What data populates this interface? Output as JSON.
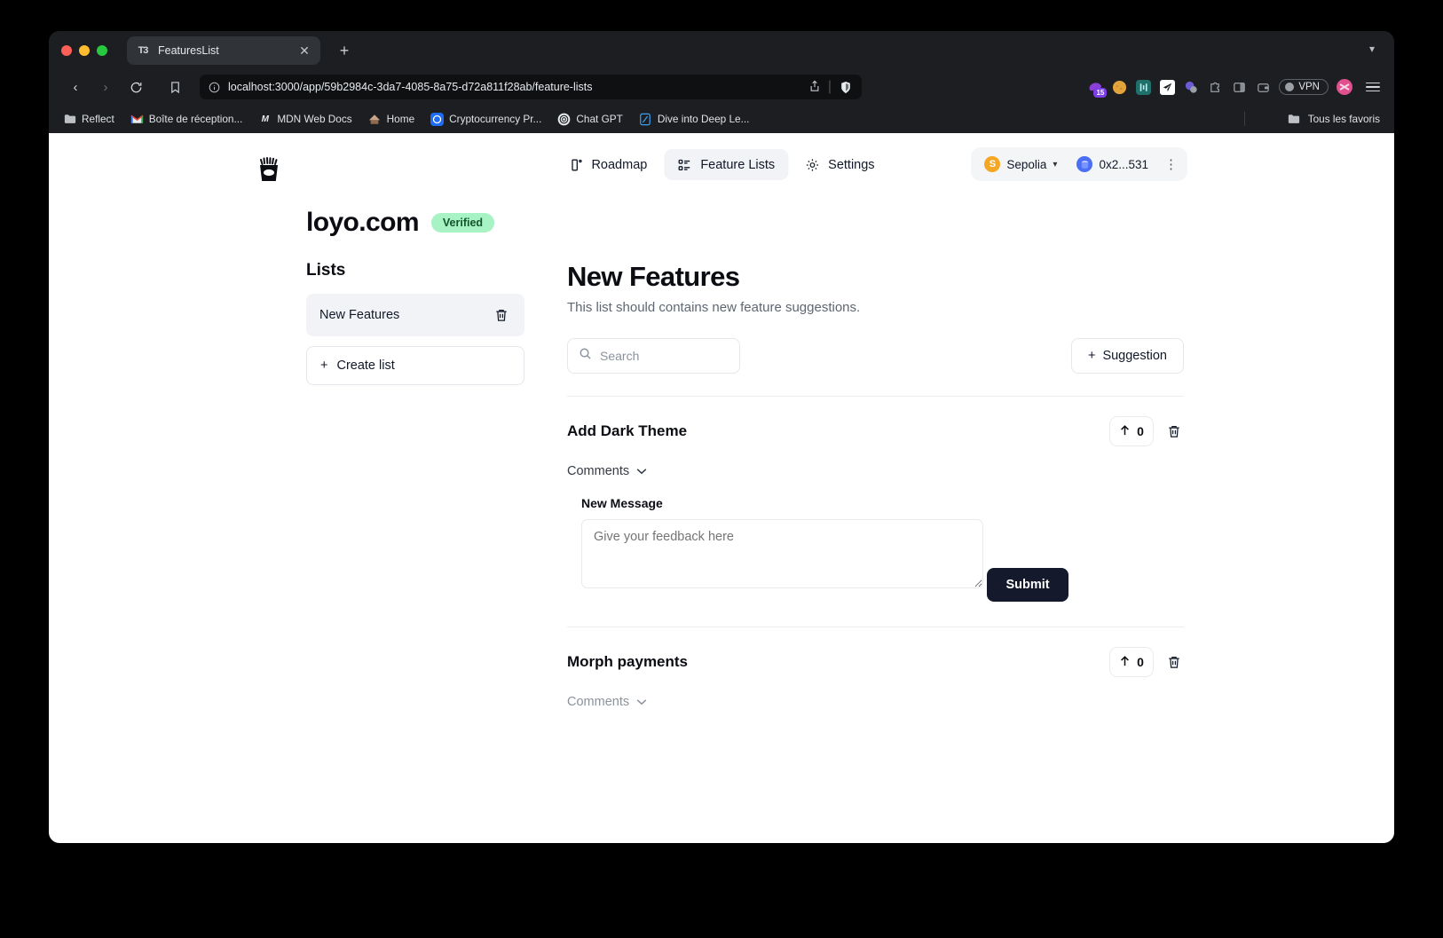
{
  "browser": {
    "tab": {
      "title": "FeaturesList",
      "favicon": "t3-icon",
      "close_icon": "close-icon"
    },
    "new_tab_icon": "plus-icon",
    "tab_list_icon": "chevron-down-icon",
    "nav": {
      "back_icon": "back-arrow-icon",
      "forward_icon": "forward-arrow-icon",
      "reload_icon": "reload-icon",
      "bookmark_icon": "bookmark-icon"
    },
    "omnibox": {
      "info_icon": "info-circle-icon",
      "url": "localhost:3000/app/59b2984c-3da7-4085-8a75-d72a811f28ab/feature-lists",
      "share_icon": "share-icon",
      "shield_icon": "brave-shield-icon"
    },
    "extensions": [
      {
        "name": "rabby-wallet-icon",
        "badge": "15",
        "color": "#8b3fd6"
      },
      {
        "name": "metamask-icon",
        "badge": "",
        "color": "#e2a33c"
      },
      {
        "name": "phantom-bars-icon",
        "badge": "",
        "color": "#1f6f6b"
      },
      {
        "name": "telegram-send-icon",
        "badge": "",
        "color": "#ffffff"
      },
      {
        "name": "copilot-icon",
        "badge": "",
        "color": "#6b5bd6"
      },
      {
        "name": "extensions-puzzle-icon",
        "badge": "",
        "color": "#9aa0a6"
      },
      {
        "name": "sidebar-panel-icon",
        "badge": "",
        "color": "#9aa0a6"
      },
      {
        "name": "wallet-card-icon",
        "badge": "",
        "color": "#9aa0a6"
      }
    ],
    "vpn": {
      "label": "VPN",
      "icon": "vpn-dot-icon"
    },
    "profile_icon": "profile-avatar-icon",
    "menu_icon": "hamburger-menu-icon",
    "bookmarks": [
      {
        "label": "Reflect",
        "icon": "folder-icon"
      },
      {
        "label": "Boîte de réception...",
        "icon": "gmail-icon"
      },
      {
        "label": "MDN Web Docs",
        "icon": "mdn-icon"
      },
      {
        "label": "Home",
        "icon": "home-icon"
      },
      {
        "label": "Cryptocurrency Pr...",
        "icon": "coinmarketcap-icon"
      },
      {
        "label": "Chat GPT",
        "icon": "openai-icon"
      },
      {
        "label": "Dive into Deep Le...",
        "icon": "d2l-icon"
      }
    ],
    "bookmarks_right": {
      "label": "Tous les favoris",
      "icon": "folder-icon"
    }
  },
  "app": {
    "logo_icon": "fries-basket-logo",
    "nav_items": [
      {
        "label": "Roadmap",
        "icon": "roadmap-icon",
        "active": false
      },
      {
        "label": "Feature Lists",
        "icon": "feature-lists-icon",
        "active": true
      },
      {
        "label": "Settings",
        "icon": "gear-icon",
        "active": false
      }
    ],
    "wallet": {
      "chain": "Sepolia",
      "chain_icon": "sepolia-icon",
      "chain_chevron": "chevron-down-icon",
      "address": "0x2...531",
      "address_icon": "account-avatar-icon",
      "kebab_icon": "kebab-menu-icon"
    },
    "site": {
      "name": "loyo.com",
      "badge": "Verified",
      "badge_color": "#a7f3c4"
    },
    "sidebar": {
      "title": "Lists",
      "items": [
        {
          "label": "New Features",
          "delete_icon": "trash-icon"
        }
      ],
      "create": {
        "label": "Create list",
        "icon": "plus-icon"
      }
    },
    "main": {
      "title": "New Features",
      "subtitle": "This list should contains new feature suggestions.",
      "search": {
        "placeholder": "Search",
        "value": "",
        "icon": "search-icon"
      },
      "suggestion_button": {
        "label": "Suggestion",
        "icon": "plus-icon"
      },
      "features": [
        {
          "title": "Add Dark Theme",
          "votes": "0",
          "vote_icon": "arrow-up-icon",
          "delete_icon": "trash-icon",
          "comments_label": "Comments",
          "comments_chevron": "chevron-down-icon",
          "expanded": true,
          "new_message": {
            "label": "New Message",
            "placeholder": "Give your feedback here",
            "value": "",
            "submit_label": "Submit"
          }
        },
        {
          "title": "Morph payments",
          "votes": "0",
          "vote_icon": "arrow-up-icon",
          "delete_icon": "trash-icon",
          "comments_label": "Comments",
          "comments_chevron": "chevron-down-icon",
          "expanded": false
        }
      ]
    }
  }
}
